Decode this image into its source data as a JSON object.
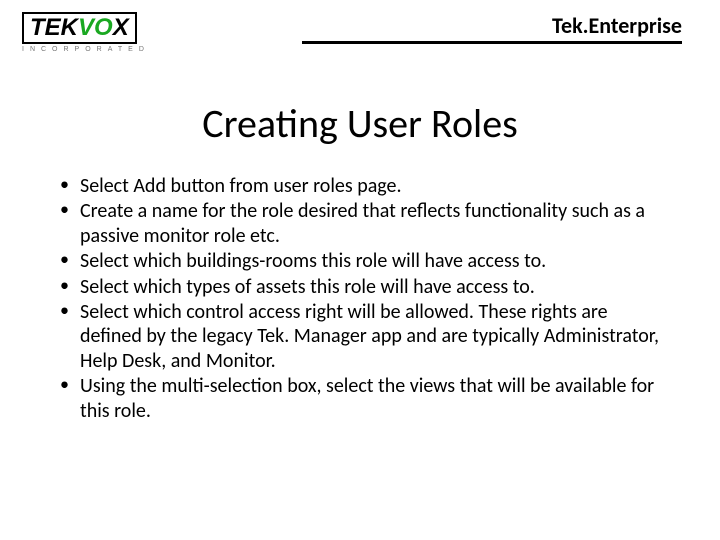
{
  "header": {
    "logo": {
      "tek": "TEK",
      "vo": "VO",
      "x": "X",
      "sub": "INCORPORATED"
    },
    "product": "Tek.Enterprise"
  },
  "title": "Creating User Roles",
  "bullets": [
    "Select Add button from user roles page.",
    "Create a name for the role desired that reflects functionality such as a passive monitor role etc.",
    "Select which buildings-rooms this role will have access to.",
    "Select which types of assets this role will have access to.",
    "Select which control access right will be allowed.  These rights are defined by the legacy Tek. Manager app and are typically Administrator, Help Desk, and Monitor.",
    "Using the multi-selection box, select the views that will be available for this role."
  ]
}
